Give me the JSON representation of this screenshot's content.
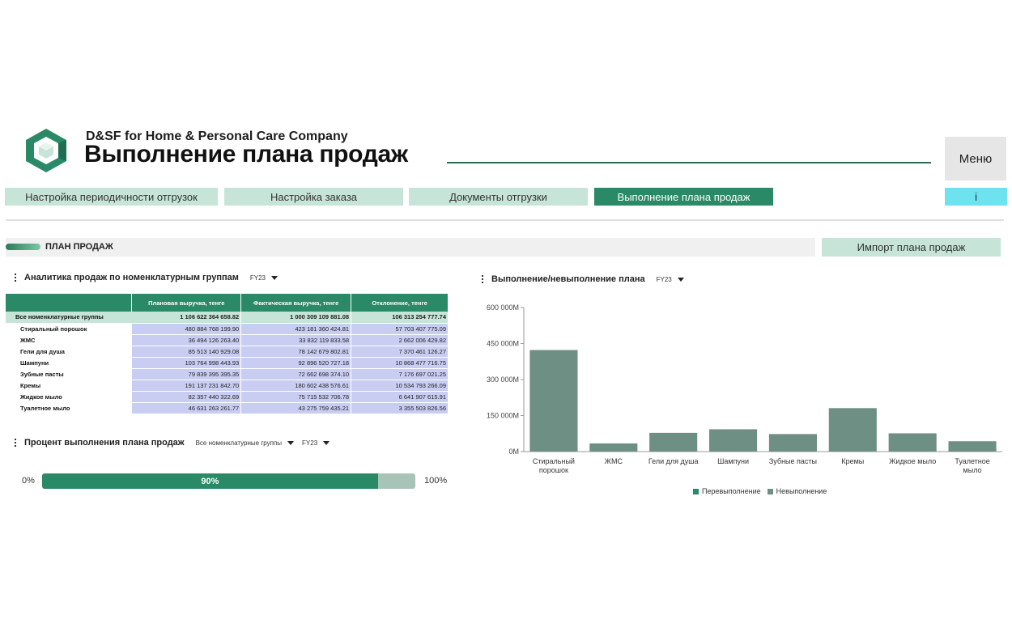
{
  "header": {
    "company": "D&SF for Home & Personal Care Company",
    "title": "Выполнение плана продаж",
    "menu_label": "Меню"
  },
  "tabs": [
    {
      "label": "Настройка периодичности отгрузок",
      "active": false
    },
    {
      "label": "Настройка заказа",
      "active": false
    },
    {
      "label": "Документы отгрузки",
      "active": false
    },
    {
      "label": "Выполнение плана продаж",
      "active": true
    }
  ],
  "info_label": "i",
  "section": {
    "label": "ПЛАН ПРОДАЖ",
    "import_button": "Импорт плана продаж"
  },
  "table_widget": {
    "title": "Аналитика продаж по номенклатурным группам",
    "period": "FY23",
    "columns": [
      "Плановая выручка, тенге",
      "Фактическая выручка, тенге",
      "Отклонение, тенге"
    ],
    "total_row": {
      "name": "Все номенклатурные группы",
      "plan": "1 106 622 364 658.82",
      "fact": "1 000 309 109 881.08",
      "diff": "106 313 254 777.74"
    },
    "rows": [
      {
        "name": "Стиральный порошок",
        "plan": "480 884 768 199.90",
        "fact": "423 181 360 424.81",
        "diff": "57 703 407 775.09"
      },
      {
        "name": "ЖМС",
        "plan": "36 494 126 263.40",
        "fact": "33 832 119 833.58",
        "diff": "2 662 006 429.82"
      },
      {
        "name": "Гели для душа",
        "plan": "85 513 140 929.08",
        "fact": "78 142 679 802.81",
        "diff": "7 370 461 126.27"
      },
      {
        "name": "Шампуни",
        "plan": "103 764 998 443.93",
        "fact": "92 896 520 727.18",
        "diff": "10 868 477 716.75"
      },
      {
        "name": "Зубные пасты",
        "plan": "79 839 395 395.35",
        "fact": "72 662 698 374.10",
        "diff": "7 176 697 021.25"
      },
      {
        "name": "Кремы",
        "plan": "191 137 231 842.70",
        "fact": "180 602 438 576.61",
        "diff": "10 534 793 266.09"
      },
      {
        "name": "Жидкое мыло",
        "plan": "82 357 440 322.69",
        "fact": "75 715 532 706.78",
        "diff": "6 641 907 615.91"
      },
      {
        "name": "Туалетное мыло",
        "plan": "46 631 263 261.77",
        "fact": "43 275 759 435.21",
        "diff": "3 355 503 826.56"
      }
    ]
  },
  "progress_widget": {
    "title": "Процент выполнения плана продаж",
    "group_filter": "Все номенклатурные группы",
    "period": "FY23",
    "min_label": "0%",
    "max_label": "100%",
    "value": 0.9,
    "value_label": "90%"
  },
  "chart_widget": {
    "title": "Выполнение/невыполнение плана",
    "period": "FY23"
  },
  "chart_data": {
    "type": "bar",
    "categories": [
      "Стиральный порошок",
      "ЖМС",
      "Гели для душа",
      "Шампуни",
      "Зубные пасты",
      "Кремы",
      "Жидкое мыло",
      "Туалетное мыло"
    ],
    "series": [
      {
        "name": "Перевыполнение",
        "values": [
          0,
          0,
          0,
          0,
          0,
          0,
          0,
          0
        ],
        "color": "#2a8a67"
      },
      {
        "name": "Невыполнение",
        "values": [
          423,
          34,
          78,
          93,
          73,
          181,
          76,
          43
        ],
        "color": "#6e8f84"
      }
    ],
    "ylim": [
      0,
      600
    ],
    "yticks": [
      0,
      150,
      300,
      450,
      600
    ],
    "ytick_labels": [
      "0M",
      "150 000M",
      "300 000M",
      "450 000M",
      "600 000M"
    ],
    "legend": "bottom",
    "grid": false
  },
  "colors": {
    "accent": "#2a8a67",
    "tab_inactive": "#c6e5d8",
    "table_value_bg": "#c9cdf2",
    "info": "#6ee3ef"
  }
}
